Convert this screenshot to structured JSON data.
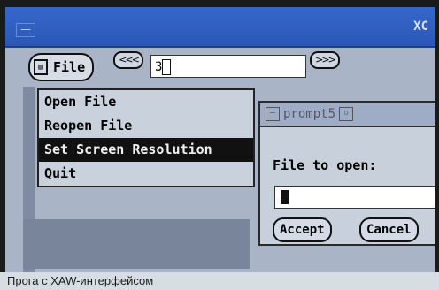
{
  "window": {
    "title": "XC",
    "close_glyph": "—"
  },
  "toolbar": {
    "file_label": "File",
    "scroll_left_glyph": "<<<",
    "scroll_right_glyph": ">>>",
    "entry_value": "3"
  },
  "menu": {
    "items": [
      {
        "label": "Open File"
      },
      {
        "label": "Reopen File"
      },
      {
        "label": "Set Screen Resolution",
        "selected": true
      },
      {
        "label": "Quit"
      }
    ]
  },
  "prompt": {
    "title": "prompt5",
    "label": "File to open:",
    "accept_label": "Accept",
    "cancel_label": "Cancel"
  },
  "caption": "Прога с XAW-интерфейсом"
}
